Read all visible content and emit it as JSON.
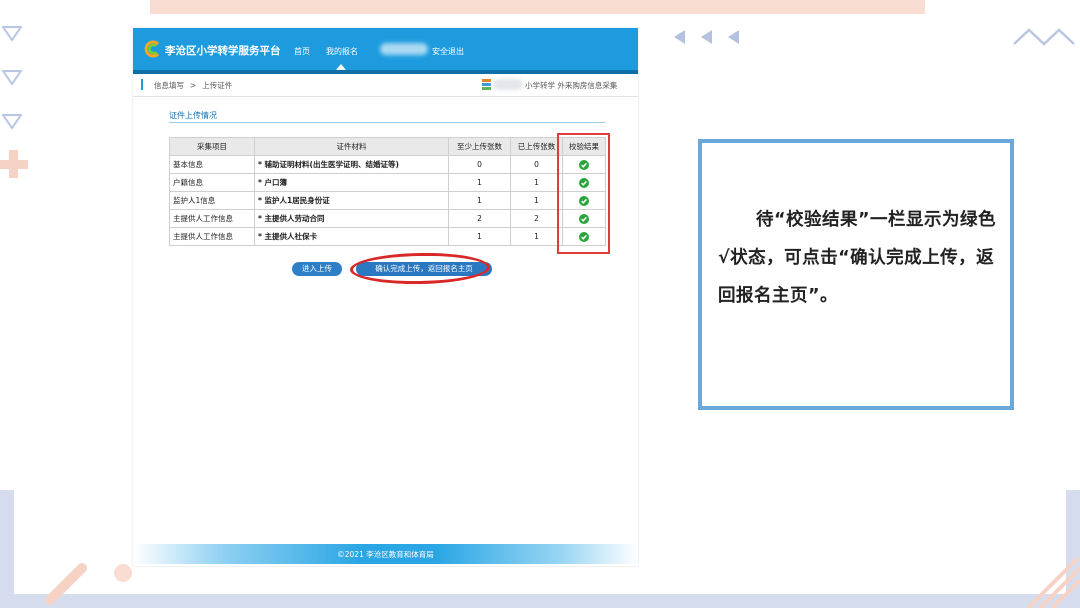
{
  "app": {
    "title": "李沧区小学转学服务平台",
    "nav": [
      {
        "label": "首页"
      },
      {
        "label": "我的报名"
      },
      {
        "label": "安全退出"
      }
    ]
  },
  "breadcrumb": {
    "items": [
      "信息填写",
      ">",
      "上传证件"
    ],
    "user_suffix": "小学转学 外来购房信息采集"
  },
  "section": {
    "title": "证件上传情况"
  },
  "table": {
    "headers": [
      "采集项目",
      "证件材料",
      "至少上传张数",
      "已上传张数",
      "校验结果"
    ],
    "rows": [
      {
        "item": "基本信息",
        "material": "* 辅助证明材料(出生医学证明、结婚证等)",
        "min": "0",
        "uploaded": "0"
      },
      {
        "item": "户籍信息",
        "material": "* 户口簿",
        "min": "1",
        "uploaded": "1"
      },
      {
        "item": "监护人1信息",
        "material": "* 监护人1居民身份证",
        "min": "1",
        "uploaded": "1"
      },
      {
        "item": "主提供人工作信息",
        "material": "* 主提供人劳动合同",
        "min": "2",
        "uploaded": "2"
      },
      {
        "item": "主提供人工作信息",
        "material": "* 主提供人社保卡",
        "min": "1",
        "uploaded": "1"
      }
    ]
  },
  "buttons": {
    "upload": "进入上传",
    "confirm": "确认完成上传，返回报名主页"
  },
  "footer": {
    "text": "©2021 李沧区教育和体育局"
  },
  "callout": {
    "text": "待“校验结果”一栏显示为绿色√状态，可点击“确认完成上传，返回报名主页”。"
  },
  "colors": {
    "header_blue": "#1d9bde",
    "check_green": "#2aa53a",
    "highlight_red": "#e23b3b",
    "callout_border": "#6aa8d9"
  }
}
